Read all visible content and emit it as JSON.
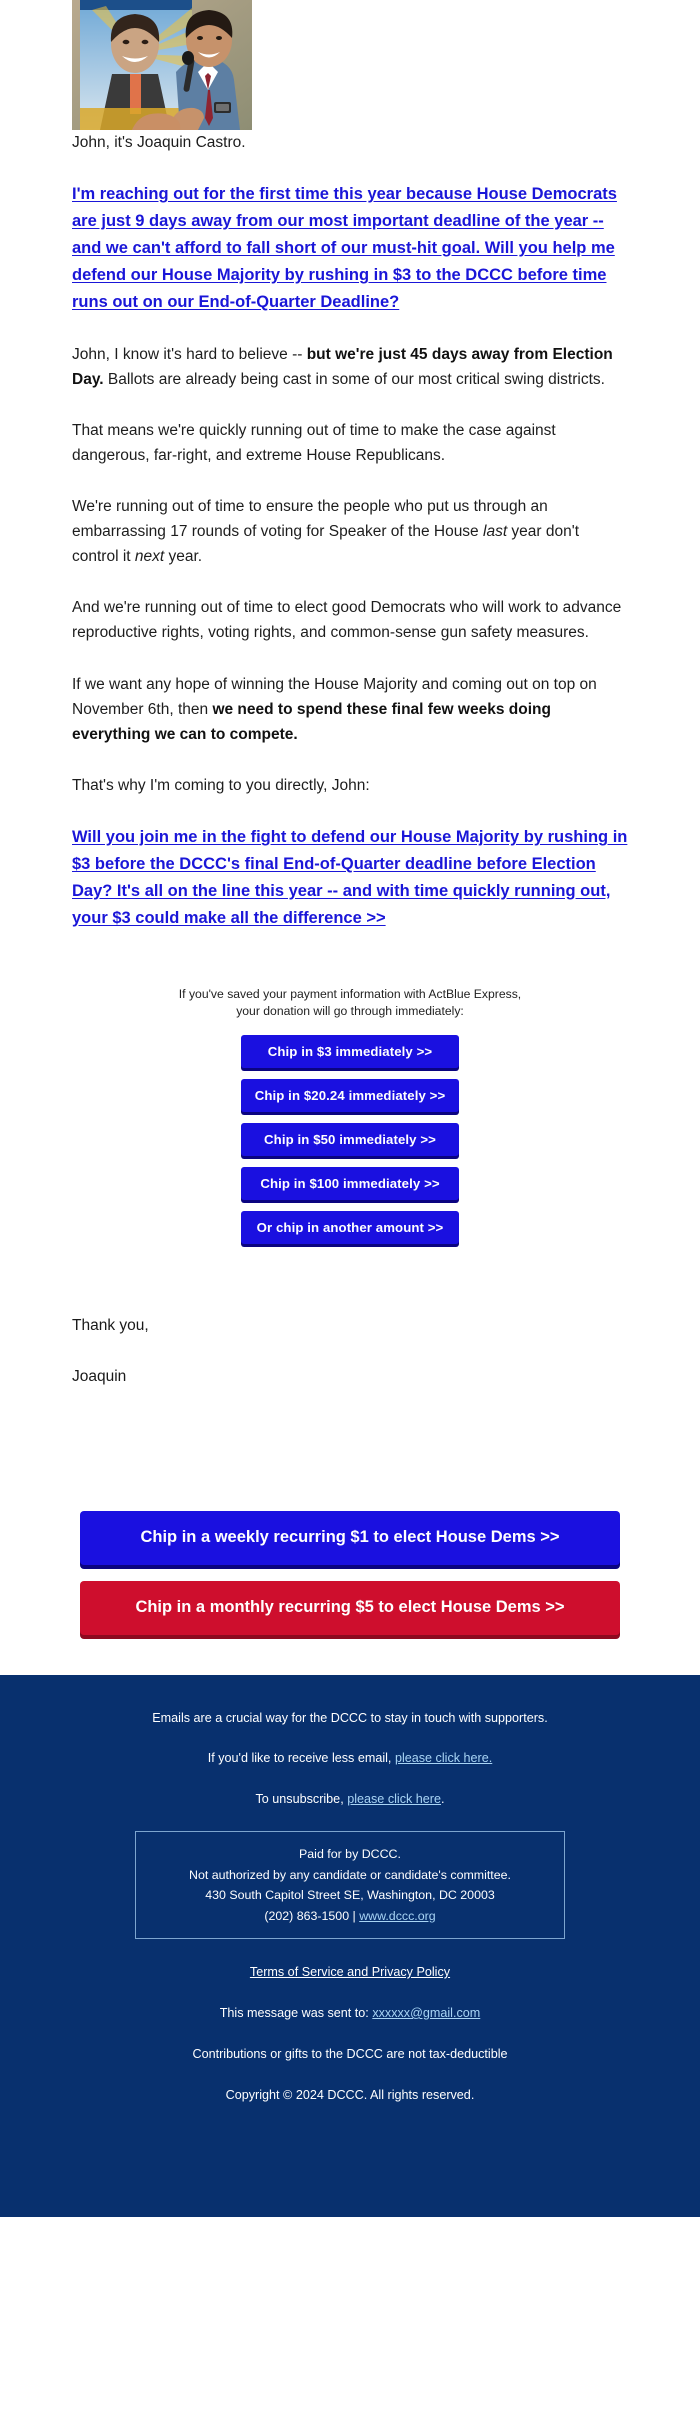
{
  "hero": {
    "alt_name": "joaquin-castro-speaking-photo"
  },
  "body": {
    "greeting": "John, it's Joaquin Castro.",
    "link1": "I'm reaching out for the first time this year because House Democrats are just 9 days away from our most important deadline of the year -- and we can't afford to fall short of our must-hit goal. Will you help me defend our House Majority by rushing in $3 to the DCCC before time runs out on our End-of-Quarter Deadline?",
    "p2_a": "John, I know it's hard to believe -- ",
    "p2_b": "but we're just 45 days away from Election Day.",
    "p2_c": " Ballots are already being cast in some of our most critical swing districts.",
    "p3": "That means we're quickly running out of time to make the case against dangerous, far-right, and extreme House Republicans.",
    "p4_a": "We're running out of time to ensure the people who put us through an embarrassing 17 rounds of voting for Speaker of the House ",
    "p4_i1": "last",
    "p4_b": " year don't control it ",
    "p4_i2": "next",
    "p4_c": " year.",
    "p5": "And we're running out of time to elect good Democrats who will work to advance reproductive rights, voting rights, and common-sense gun safety measures.",
    "p6_a": "If we want any hope of winning the House Majority and coming out on top on November 6th, then ",
    "p6_b": "we need to spend these final few weeks doing everything we can to compete.",
    "p7": "That's why I'm coming to you directly, John:",
    "link2": "Will you join me in the fight to defend our House Majority by rushing in $3 before the DCCC's final End-of-Quarter deadline before Election Day? It's all on the line this year -- and with time quickly running out, your $3 could make all the difference >>",
    "thanks": "Thank you,",
    "signature": "Joaquin"
  },
  "donate": {
    "express_note_line1": "If you've saved your payment information with ActBlue Express,",
    "express_note_line2": "your donation will go through immediately:",
    "buttons": [
      {
        "label": "Chip in $3 immediately >>",
        "amount": "3"
      },
      {
        "label": "Chip in $20.24 immediately >>",
        "amount": "20.24"
      },
      {
        "label": "Chip in $50 immediately >>",
        "amount": "50"
      },
      {
        "label": "Chip in $100 immediately >>",
        "amount": "100"
      },
      {
        "label": "Or chip in another amount >>",
        "amount": "other"
      }
    ]
  },
  "recurring": {
    "weekly_label": "Chip in a weekly recurring $1 to elect House Dems >>",
    "monthly_label": "Chip in a monthly recurring $5 to elect House Dems >>"
  },
  "footer": {
    "line1": "Emails are a crucial way for the DCCC to stay in touch with supporters.",
    "line2_prefix": "If you'd like to receive less email, ",
    "line2_link": "please click here.",
    "line3_prefix": "To unsubscribe, ",
    "line3_link": "please click here",
    "line3_suffix": ".",
    "disclaimer": {
      "paid_for": "Paid for by DCCC.",
      "not_authorized": "Not authorized by any candidate or candidate's committee.",
      "address": "430 South Capitol Street SE, Washington, DC 20003",
      "phone": "(202) 863-1500 | ",
      "website": "www.dccc.org"
    },
    "terms": "Terms of Service and Privacy Policy",
    "sent_to_prefix": "This message was sent to: ",
    "sent_to_email": "xxxxxx@gmail.com",
    "tax": "Contributions or gifts to the DCCC are not tax-deductible",
    "copyright": "Copyright © 2024 DCCC. All rights reserved."
  },
  "colors": {
    "link_blue": "#1a16d8",
    "button_blue": "#1a10e0",
    "button_red": "#ce0e2d",
    "footer_navy": "#08306e"
  }
}
